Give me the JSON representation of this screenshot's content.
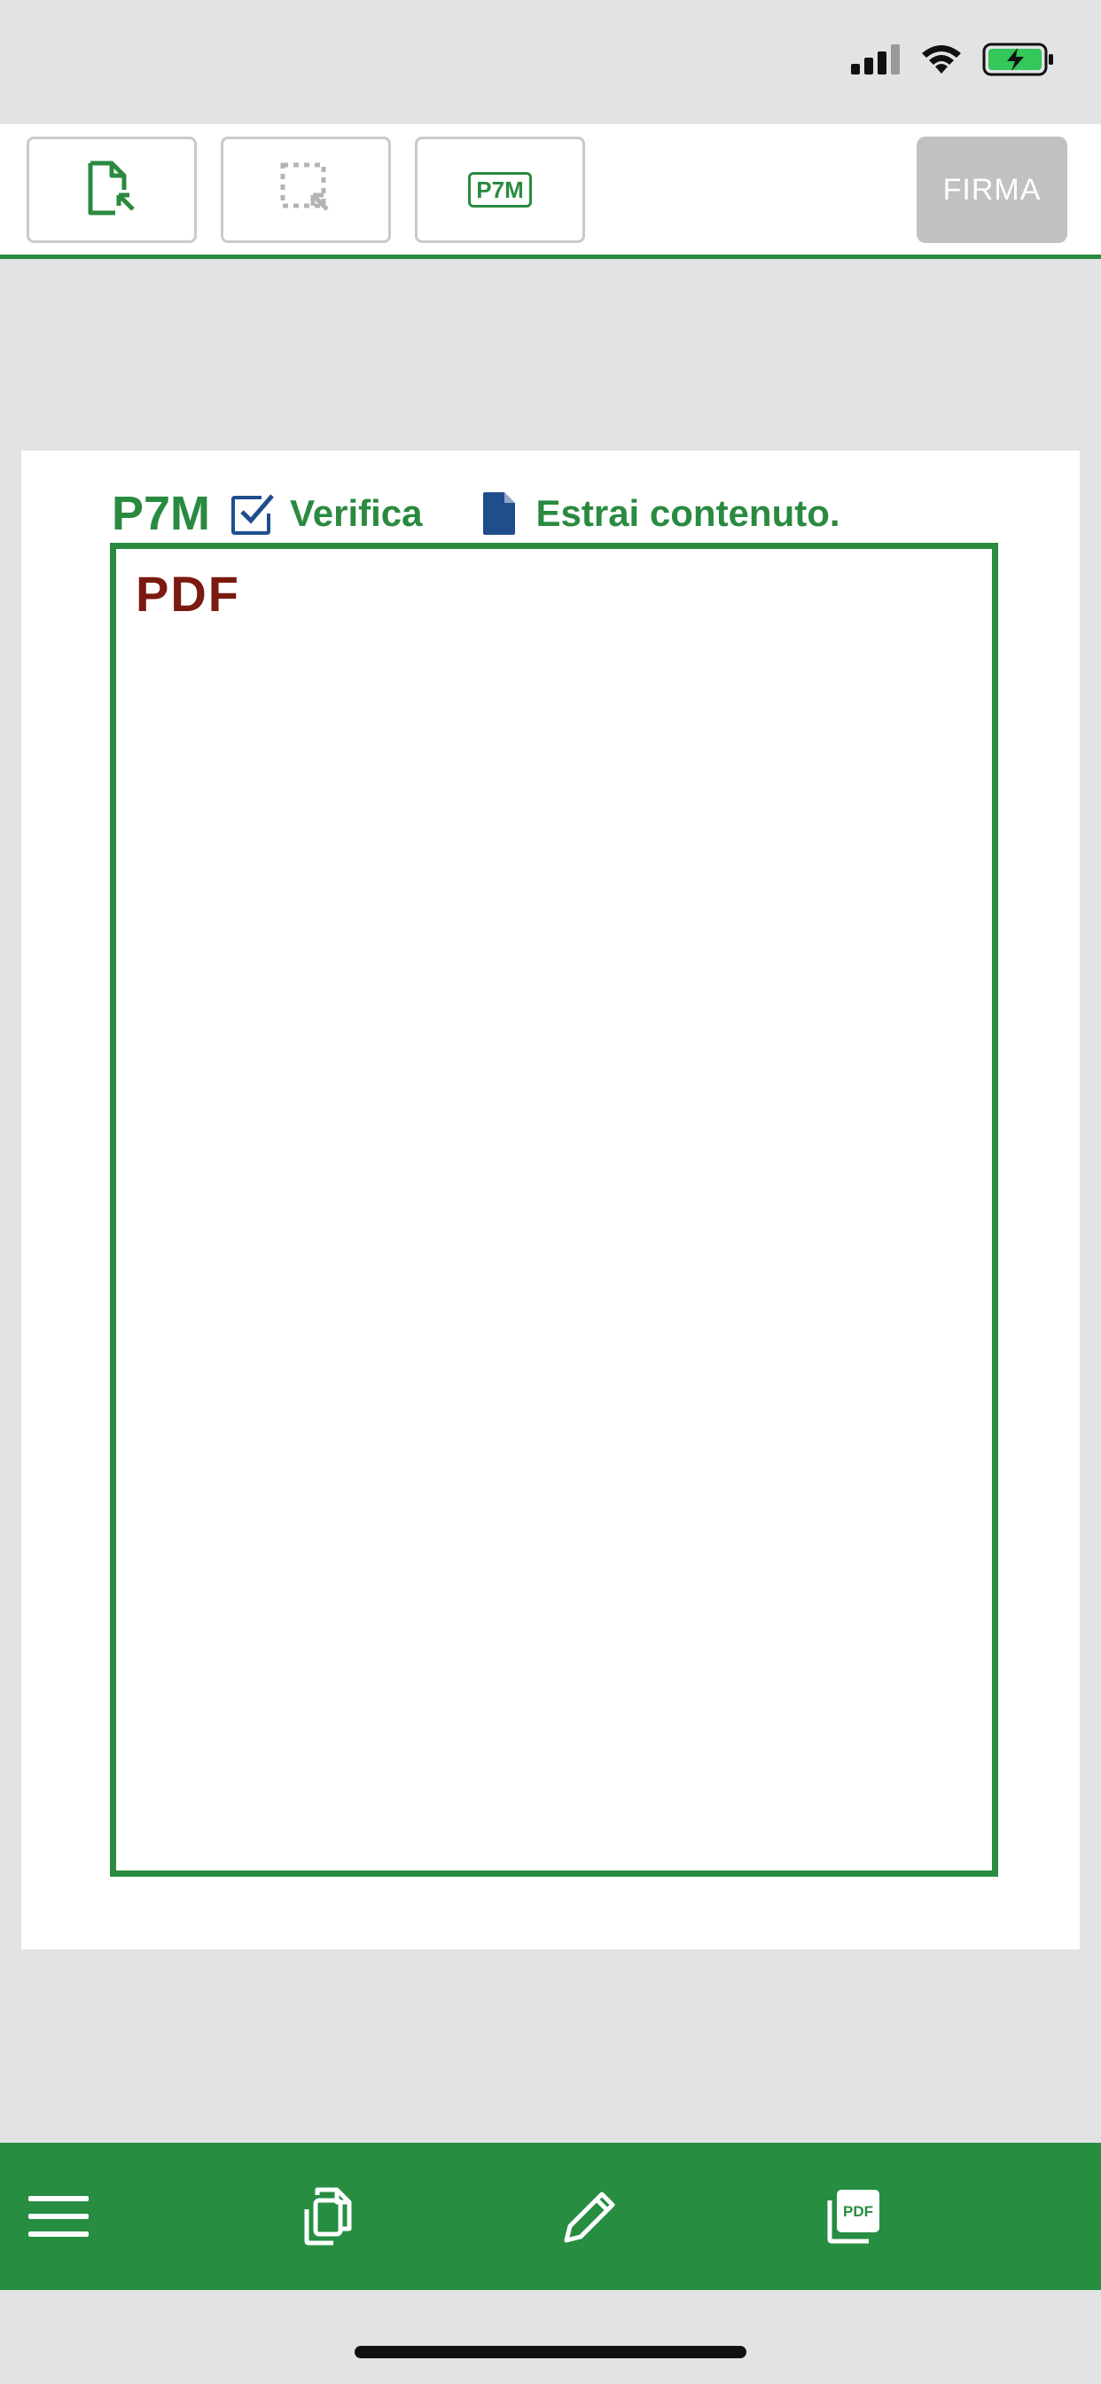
{
  "toolbar": {
    "p7m_button_label": "P7M",
    "firma_label": "FIRMA"
  },
  "document": {
    "header_label": "P7M",
    "verify_label": "Verifica",
    "extract_label": "Estrai contenuto.",
    "content_label": "PDF"
  },
  "bottom_nav": {
    "items": [
      {
        "icon": "menu-icon"
      },
      {
        "icon": "copy-documents-icon"
      },
      {
        "icon": "pencil-icon"
      },
      {
        "icon": "pdf-stack-icon",
        "label": "PDF"
      }
    ]
  },
  "colors": {
    "accent_green": "#2a8a40",
    "nav_green": "#268d41",
    "pdf_red": "#7a1a10",
    "doc_icon_blue": "#1f4e8c",
    "firma_disabled": "#c2c0c2"
  }
}
